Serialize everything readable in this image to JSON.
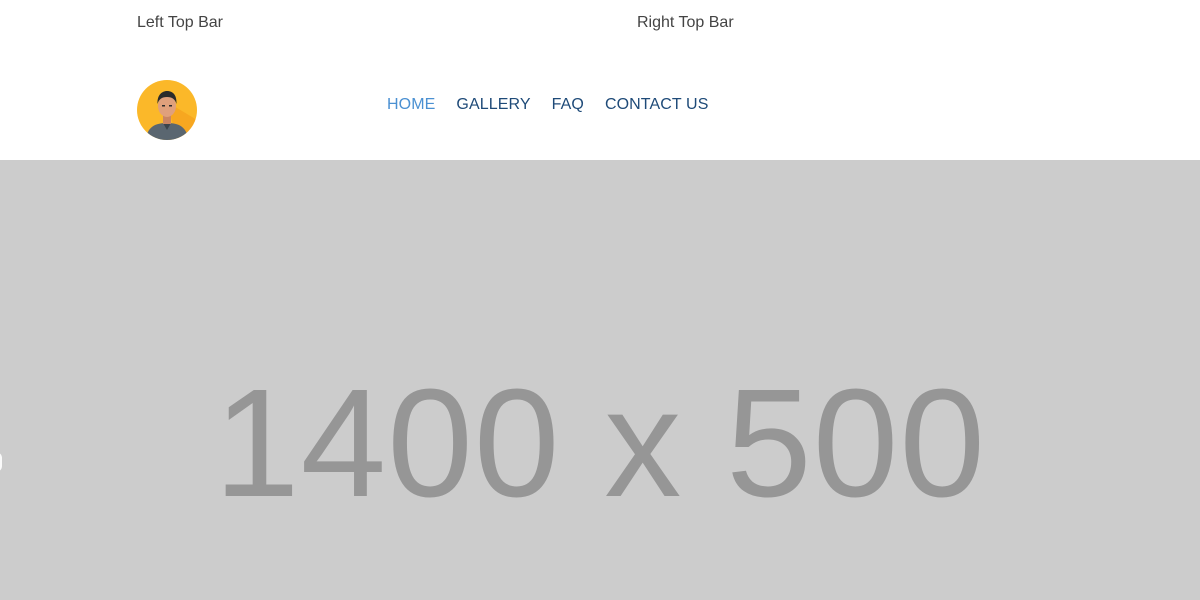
{
  "topbar": {
    "left_text": "Left Top Bar",
    "right_text": "Right Top Bar"
  },
  "header": {
    "logo_icon": "avatar-man-icon",
    "nav": [
      {
        "label": "HOME",
        "active": true
      },
      {
        "label": "GALLERY",
        "active": false
      },
      {
        "label": "FAQ",
        "active": false
      },
      {
        "label": "CONTACT US",
        "active": false
      }
    ]
  },
  "hero": {
    "placeholder_text": "1400 x 500",
    "background_color": "#cccccc",
    "text_color": "#969696"
  },
  "colors": {
    "nav_active": "#4a90d2",
    "nav_default": "#1e4a78",
    "logo_circle": "#fbb829"
  }
}
